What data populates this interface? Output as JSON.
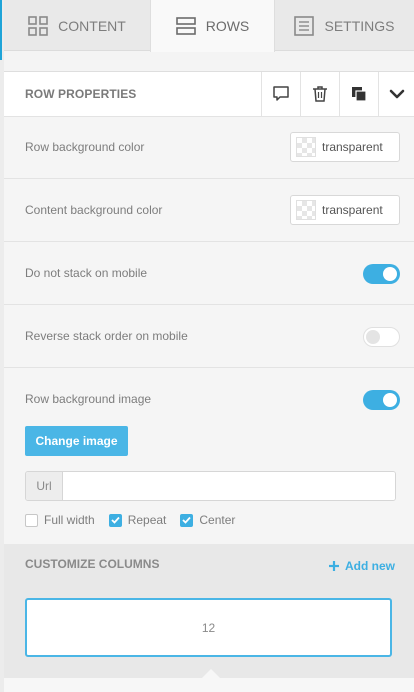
{
  "tabs": [
    {
      "label": "CONTENT",
      "icon": "grid-icon"
    },
    {
      "label": "ROWS",
      "icon": "rows-icon",
      "active": true
    },
    {
      "label": "SETTINGS",
      "icon": "settings-list-icon"
    }
  ],
  "row_properties": {
    "title": "ROW PROPERTIES",
    "actions": [
      "comment-icon",
      "trash-icon",
      "duplicate-icon",
      "chevron-down-icon"
    ]
  },
  "settings": {
    "row_bg_label": "Row background color",
    "row_bg_value": "transparent",
    "content_bg_label": "Content background color",
    "content_bg_value": "transparent",
    "no_stack_label": "Do not stack on mobile",
    "no_stack_on": true,
    "reverse_label": "Reverse stack order on mobile",
    "reverse_on": false,
    "bg_image_label": "Row background image",
    "bg_image_on": true,
    "change_image_label": "Change image",
    "url_addon": "Url",
    "url_value": "",
    "full_width_label": "Full width",
    "full_width_checked": false,
    "repeat_label": "Repeat",
    "repeat_checked": true,
    "center_label": "Center",
    "center_checked": true
  },
  "columns": {
    "title": "CUSTOMIZE COLUMNS",
    "add_new_label": "Add new",
    "column_values": [
      "12"
    ]
  },
  "colors": {
    "accent": "#3dafe2",
    "button": "#4ab6e6"
  }
}
